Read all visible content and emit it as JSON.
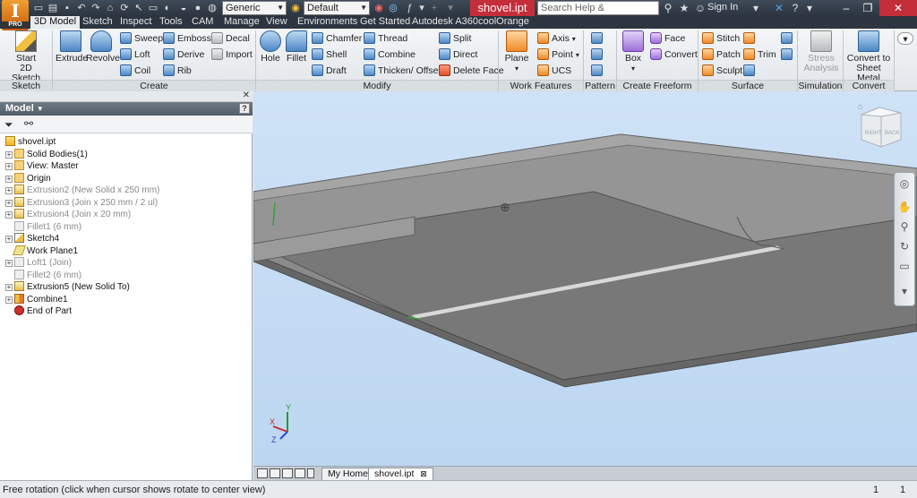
{
  "titlebar": {
    "logo_letter": "I",
    "logo_badge": "PRO",
    "material_combo": "Generic",
    "appearance_combo": "Default",
    "doc_title": "shovel.ipt",
    "search_placeholder": "Search Help & Commands...",
    "signin": "Sign In"
  },
  "tabs": [
    {
      "label": "3D Model",
      "active": true
    },
    {
      "label": "Sketch"
    },
    {
      "label": "Inspect"
    },
    {
      "label": "Tools"
    },
    {
      "label": "CAM"
    },
    {
      "label": "Manage"
    },
    {
      "label": "View"
    },
    {
      "label": "Environments"
    },
    {
      "label": "Get Started"
    },
    {
      "label": "Autodesk A360"
    },
    {
      "label": "coolOrange"
    }
  ],
  "ribbon": {
    "sketch": {
      "label": "Sketch",
      "start_line1": "Start",
      "start_line2": "2D Sketch"
    },
    "create": {
      "label": "Create",
      "extrude": "Extrude",
      "revolve": "Revolve",
      "sweep": "Sweep",
      "loft": "Loft",
      "coil": "Coil",
      "emboss": "Emboss",
      "derive": "Derive",
      "rib": "Rib",
      "decal": "Decal",
      "import": "Import"
    },
    "modify": {
      "label": "Modify",
      "hole": "Hole",
      "fillet": "Fillet",
      "chamfer": "Chamfer",
      "shell": "Shell",
      "draft": "Draft",
      "thread": "Thread",
      "combine": "Combine",
      "thicken": "Thicken/ Offset",
      "split": "Split",
      "direct": "Direct",
      "delete_face": "Delete Face"
    },
    "work_features": {
      "label": "Work Features",
      "plane": "Plane",
      "axis": "Axis",
      "point": "Point",
      "ucs": "UCS"
    },
    "pattern": {
      "label": "Pattern"
    },
    "freeform": {
      "label": "Create Freeform",
      "box": "Box",
      "face": "Face",
      "convert": "Convert"
    },
    "surface": {
      "label": "Surface",
      "stitch": "Stitch",
      "patch": "Patch",
      "sculpt": "Sculpt",
      "trim": "Trim"
    },
    "simulation": {
      "label": "Simulation",
      "stress_line1": "Stress",
      "stress_line2": "Analysis"
    },
    "convert": {
      "label": "Convert",
      "sheet_line1": "Convert to",
      "sheet_line2": "Sheet Metal"
    }
  },
  "browser": {
    "title": "Model",
    "help": "?",
    "items": [
      {
        "label": "shovel.ipt",
        "icon": "part-icon",
        "indent": 0,
        "expander": "",
        "dim": false
      },
      {
        "label": "Solid Bodies(1)",
        "icon": "folder-icon",
        "indent": 1,
        "expander": "+",
        "dim": false
      },
      {
        "label": "View: Master",
        "icon": "view-icon",
        "indent": 1,
        "expander": "+",
        "dim": false
      },
      {
        "label": "Origin",
        "icon": "folder-icon",
        "indent": 1,
        "expander": "+",
        "dim": false
      },
      {
        "label": "Extrusion2 (New Solid x 250 mm)",
        "icon": "extrude-icon",
        "indent": 1,
        "expander": "+",
        "dim": true
      },
      {
        "label": "Extrusion3 (Join x 250 mm / 2 ul)",
        "icon": "extrude-icon",
        "indent": 1,
        "expander": "+",
        "dim": true
      },
      {
        "label": "Extrusion4 (Join x 20 mm)",
        "icon": "extrude-icon",
        "indent": 1,
        "expander": "+",
        "dim": true
      },
      {
        "label": "Fillet1 (6 mm)",
        "icon": "fillet-icon",
        "indent": 1,
        "expander": "",
        "dim": true
      },
      {
        "label": "Sketch4",
        "icon": "sketch-icon",
        "indent": 1,
        "expander": "+",
        "dim": false
      },
      {
        "label": "Work Plane1",
        "icon": "plane-icon",
        "indent": 1,
        "expander": "",
        "dim": false
      },
      {
        "label": "Loft1 (Join)",
        "icon": "loft-icon",
        "indent": 1,
        "expander": "+",
        "dim": true
      },
      {
        "label": "Fillet2 (6 mm)",
        "icon": "fillet-icon",
        "indent": 1,
        "expander": "",
        "dim": true
      },
      {
        "label": "Extrusion5 (New Solid To)",
        "icon": "extrude-icon",
        "indent": 1,
        "expander": "+",
        "dim": false
      },
      {
        "label": "Combine1",
        "icon": "combine-icon",
        "indent": 1,
        "expander": "+",
        "dim": false
      },
      {
        "label": "End of Part",
        "icon": "end-of-part-icon",
        "indent": 1,
        "expander": "",
        "dim": false
      }
    ]
  },
  "viewcube": {
    "right": "RIGHT",
    "back": "BACK"
  },
  "axes": {
    "x": "X",
    "y": "Y",
    "z": "Z"
  },
  "doctabs": {
    "home": "My Home",
    "file": "shovel.ipt",
    "file_close": "⊠"
  },
  "status": {
    "text": "Free rotation (click when cursor shows rotate to center view)",
    "num1": "1",
    "num2": "1"
  }
}
